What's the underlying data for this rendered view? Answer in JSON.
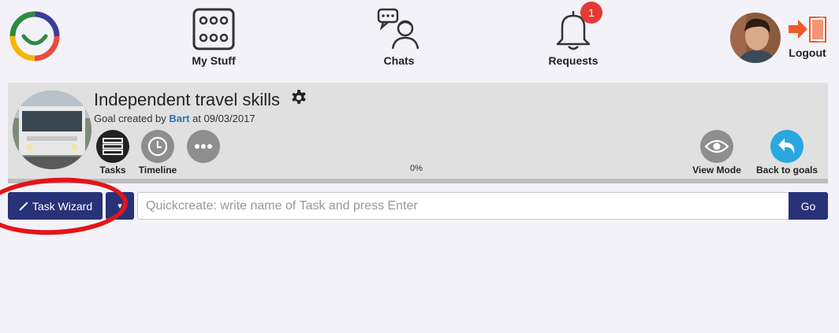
{
  "nav": {
    "my_stuff": "My Stuff",
    "chats": "Chats",
    "requests": "Requests",
    "requests_badge": "1",
    "logout": "Logout"
  },
  "goal": {
    "title": "Independent travel skills",
    "created_prefix": "Goal created by",
    "author": "Bart",
    "created_suffix": "at 09/03/2017",
    "tasks_label": "Tasks",
    "timeline_label": "Timeline",
    "progress": "0%",
    "view_mode_label": "View Mode",
    "back_label": "Back to goals"
  },
  "toolbar": {
    "task_wizard_label": "Task Wizard",
    "quickcreate_placeholder": "Quickcreate: write name of Task and press Enter",
    "go_label": "Go"
  },
  "colors": {
    "primary": "#283278",
    "badge": "#e53935",
    "link": "#2f6fb5",
    "back_button": "#29a8e0",
    "annotation_ring": "#e3141a"
  },
  "icons": [
    "app-logo-icon",
    "dice-grid-icon",
    "chat-person-icon",
    "bell-icon",
    "logout-door-icon",
    "gear-icon",
    "tasks-list-icon",
    "timeline-clock-icon",
    "more-dots-icon",
    "eye-icon",
    "back-arrow-icon",
    "magic-wand-icon",
    "caret-down-icon"
  ]
}
